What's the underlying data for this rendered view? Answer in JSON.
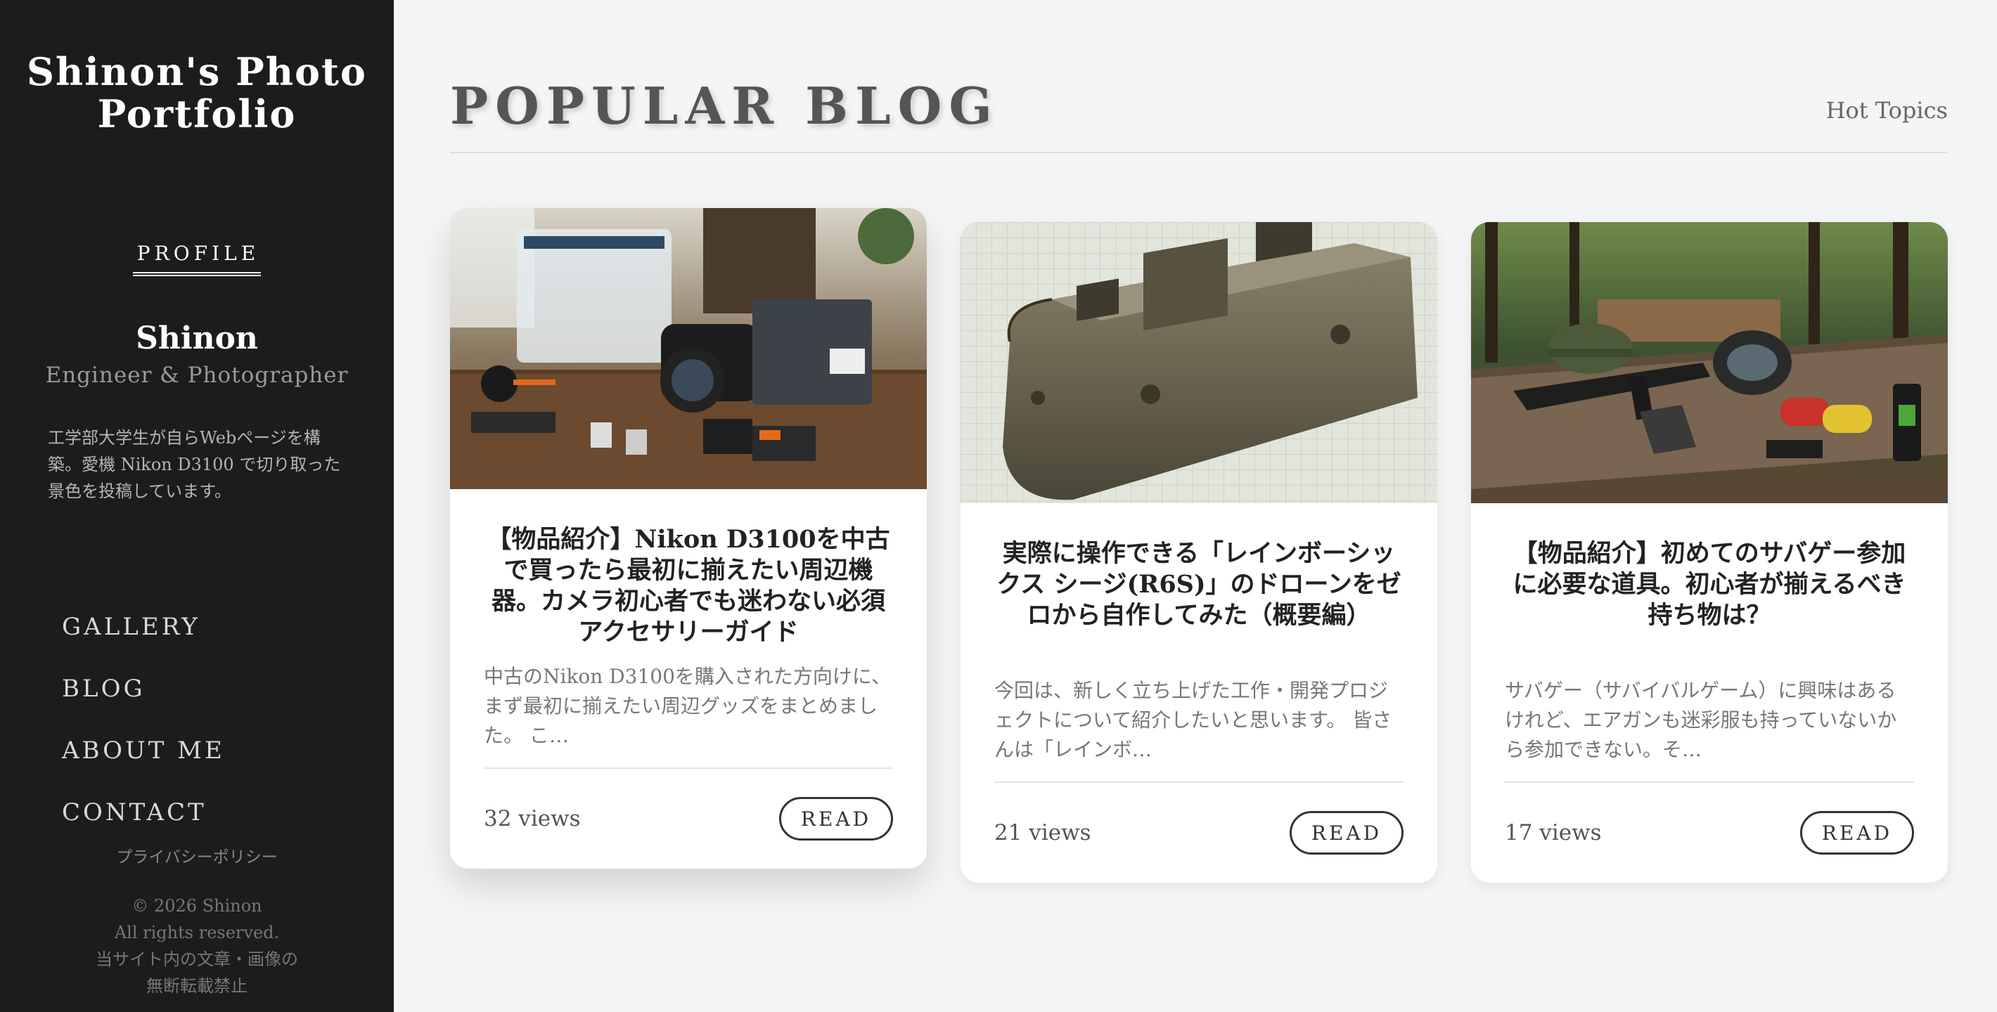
{
  "sidebar": {
    "site_title_line1": "Shinon's Photo",
    "site_title_line2": "Portfolio",
    "profile_heading": "PROFILE",
    "profile_name": "Shinon",
    "profile_role": "Engineer & Photographer",
    "profile_bio": "工学部大学生が自らWebページを構築。愛機 Nikon D3100 で切り取った景色を投稿しています。",
    "nav": [
      "GALLERY",
      "BLOG",
      "ABOUT ME",
      "CONTACT"
    ],
    "privacy_link": "プライバシーポリシー",
    "copyright": [
      "© 2026 Shinon",
      "All rights reserved.",
      "当サイト内の文章・画像の",
      "無断転載禁止"
    ]
  },
  "main": {
    "section_title": "POPULAR BLOG",
    "hot_topics": "Hot Topics",
    "cards": [
      {
        "title": "【物品紹介】Nikon D3100を中古で買ったら最初に揃えたい周辺機器。カメラ初心者でも迷わない必須アクセサリーガイド",
        "excerpt": "中古のNikon D3100を購入された方向けに、まず最初に揃えたい周辺グッズをまとめました。 こ…",
        "views": "32 views",
        "read_label": "READ"
      },
      {
        "title": "実際に操作できる「レインボーシックス シージ(R6S)」のドローンをゼロから自作してみた（概要編）",
        "excerpt": "今回は、新しく立ち上げた工作・開発プロジェクトについて紹介したいと思います。 皆さんは「レインボ…",
        "views": "21 views",
        "read_label": "READ"
      },
      {
        "title": "【物品紹介】初めてのサバゲー参加に必要な道具。初心者が揃えるべき持ち物は？",
        "excerpt": "サバゲー（サバイバルゲーム）に興味はあるけれど、エアガンも迷彩服も持っていないから参加できない。そ…",
        "views": "17 views",
        "read_label": "READ"
      }
    ]
  }
}
